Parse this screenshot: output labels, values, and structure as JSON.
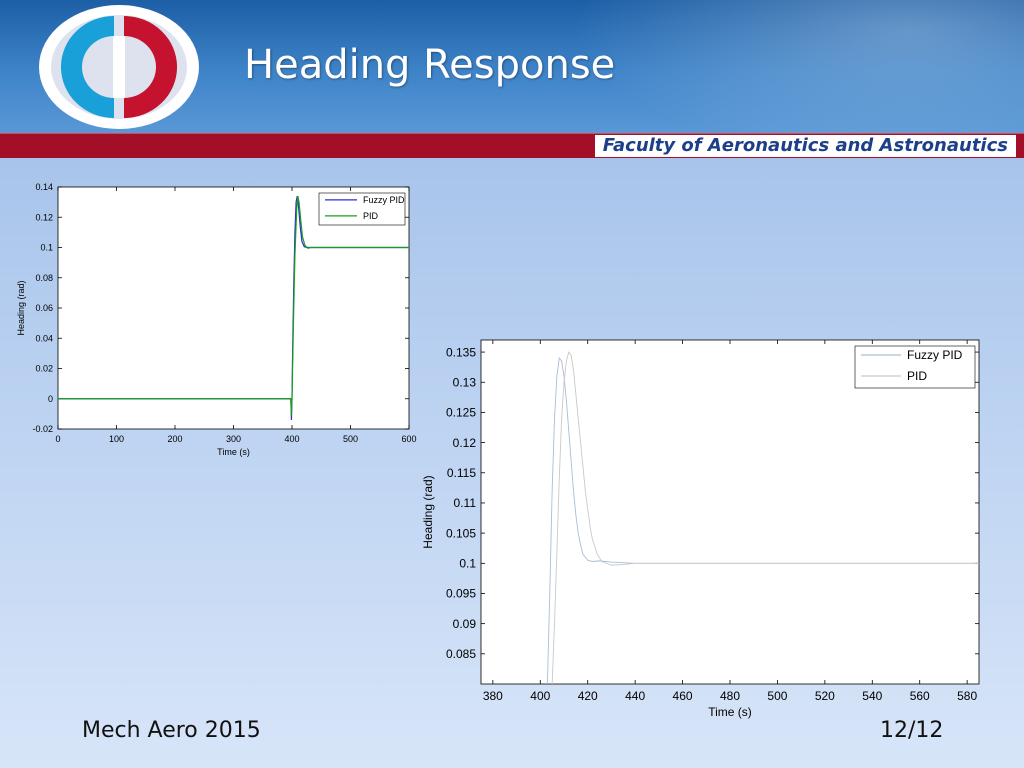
{
  "slide": {
    "title": "Heading Response",
    "faculty": "Faculty of Aeronautics and Astronautics",
    "footer_left": "Mech Aero 2015",
    "page_number": "12/12",
    "logo_icon": "university-logo-icon",
    "colors": {
      "header_blue": "#2f74bf",
      "band_red": "#a30f28",
      "logo_red": "#c4122f",
      "logo_cyan": "#1aa0d8"
    }
  },
  "chart_data": [
    {
      "type": "line",
      "xlabel": "Time (s)",
      "ylabel": "Heading (rad)",
      "xlim": [
        0,
        600
      ],
      "ylim": [
        -0.02,
        0.14
      ],
      "xticks": [
        0,
        100,
        200,
        300,
        400,
        500,
        600
      ],
      "yticks": [
        -0.02,
        0,
        0.02,
        0.04,
        0.06,
        0.08,
        0.1,
        0.12,
        0.14
      ],
      "xtick_labels": [
        "0",
        "100",
        "200",
        "300",
        "400",
        "500",
        "600"
      ],
      "ytick_labels": [
        "-0.02",
        "0",
        "0.02",
        "0.04",
        "0.06",
        "0.08",
        "0.1",
        "0.12",
        "0.14"
      ],
      "legend": "top-right",
      "series": [
        {
          "name": "Fuzzy PID",
          "color": "#2b2bd9",
          "x": [
            0,
            398,
            399,
            400,
            401,
            403,
            405,
            407,
            409,
            411,
            414,
            417,
            421,
            426,
            440,
            600
          ],
          "y": [
            0,
            0,
            -0.014,
            0,
            0.03,
            0.075,
            0.11,
            0.13,
            0.134,
            0.128,
            0.114,
            0.104,
            0.1005,
            0.1,
            0.1,
            0.1
          ]
        },
        {
          "name": "PID",
          "color": "#1a9e1a",
          "x": [
            0,
            398,
            399,
            400,
            401,
            403,
            405,
            408,
            410,
            412,
            415,
            418,
            422,
            427,
            432,
            440,
            600
          ],
          "y": [
            0,
            0,
            -0.011,
            0,
            0.02,
            0.06,
            0.095,
            0.125,
            0.134,
            0.13,
            0.118,
            0.107,
            0.1015,
            0.0995,
            0.1,
            0.1,
            0.1
          ]
        }
      ]
    },
    {
      "type": "line",
      "xlabel": "Time (s)",
      "ylabel": "Heading (rad)",
      "xlim": [
        375,
        585
      ],
      "ylim": [
        0.08,
        0.137
      ],
      "xticks": [
        380,
        400,
        420,
        440,
        460,
        480,
        500,
        520,
        540,
        560,
        580
      ],
      "yticks": [
        0.085,
        0.09,
        0.095,
        0.1,
        0.105,
        0.11,
        0.115,
        0.12,
        0.125,
        0.13,
        0.135
      ],
      "xtick_labels": [
        "380",
        "400",
        "420",
        "440",
        "460",
        "480",
        "500",
        "520",
        "540",
        "560",
        "580"
      ],
      "ytick_labels": [
        "0.085",
        "0.09",
        "0.095",
        "0.1",
        "0.105",
        "0.11",
        "0.115",
        "0.12",
        "0.125",
        "0.13",
        "0.135"
      ],
      "legend": "top-right",
      "series": [
        {
          "name": "Fuzzy PID",
          "color": "#a9bdd6",
          "x": [
            403,
            404,
            405,
            406,
            407,
            408,
            409,
            410,
            411,
            412,
            413,
            414,
            415,
            416,
            417,
            418,
            420,
            422,
            425,
            430,
            440,
            460,
            585
          ],
          "y": [
            0.08,
            0.095,
            0.112,
            0.124,
            0.131,
            0.134,
            0.1335,
            0.131,
            0.127,
            0.122,
            0.117,
            0.112,
            0.108,
            0.105,
            0.103,
            0.1015,
            0.1005,
            0.1003,
            0.1004,
            0.1002,
            0.1,
            0.1,
            0.1
          ]
        },
        {
          "name": "PID",
          "color": "#c9c9c9",
          "x": [
            405,
            406,
            407,
            408,
            409,
            410,
            411,
            412,
            413,
            414,
            415,
            416,
            417,
            418,
            419,
            420,
            421,
            422,
            424,
            426,
            430,
            435,
            440,
            460,
            585
          ],
          "y": [
            0.08,
            0.09,
            0.102,
            0.114,
            0.124,
            0.13,
            0.1335,
            0.135,
            0.1345,
            0.132,
            0.128,
            0.124,
            0.12,
            0.116,
            0.112,
            0.109,
            0.106,
            0.104,
            0.1015,
            0.1003,
            0.0997,
            0.0998,
            0.1,
            0.1,
            0.1
          ]
        }
      ]
    }
  ]
}
